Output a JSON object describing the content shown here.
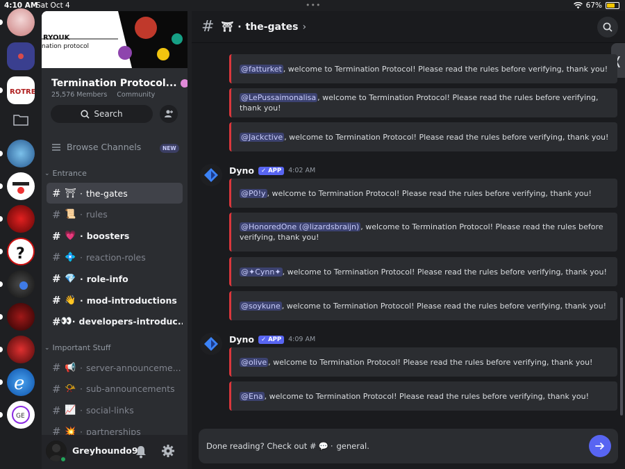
{
  "status_bar": {
    "time": "4:10 AM",
    "date": "Sat Oct 4",
    "battery": "67%",
    "battery_level": 0.67
  },
  "guild": {
    "name": "Termination Protocol...",
    "members": "25,576 Members",
    "type": "Community",
    "banner_text": "nation protocol",
    "banner_logo": "RYOUK",
    "search_label": "Search",
    "browse_label": "Browse Channels",
    "new_badge": "NEW"
  },
  "categories": {
    "entrance": "Entrance",
    "important": "Important Stuff"
  },
  "channels": [
    {
      "emoji": "⛩",
      "name": "the-gates",
      "state": "active"
    },
    {
      "emoji": "📜",
      "name": "rules",
      "state": "muted"
    },
    {
      "emoji": "💗",
      "name": "boosters",
      "state": "unread"
    },
    {
      "emoji": "💠",
      "name": "reaction-roles",
      "state": "muted"
    },
    {
      "emoji": "💎",
      "name": "role-info",
      "state": "unread"
    },
    {
      "emoji": "👋",
      "name": "mod-introductions",
      "state": "unread"
    },
    {
      "emoji": "👀",
      "name": "developers-introduc...",
      "state": "unread"
    },
    {
      "emoji": "📢",
      "name": "server-announceme...",
      "state": "muted"
    },
    {
      "emoji": "📯",
      "name": "sub-announcements",
      "state": "muted"
    },
    {
      "emoji": "📈",
      "name": "social-links",
      "state": "muted"
    },
    {
      "emoji": "💥",
      "name": "partnerships",
      "state": "muted"
    }
  ],
  "user": {
    "name": "Greyhoundo9"
  },
  "header": {
    "emoji": "⛩",
    "channel": "the-gates",
    "chevron": "›",
    "drawer_icon": "❬"
  },
  "welcome_suffix": ", welcome to Termination Protocol! Please read the rules before verifying, thank you!",
  "messages_top": [
    {
      "mention": "@fatturket"
    },
    {
      "mention": "@LePussaimonalisa"
    },
    {
      "mention": "@Jackctive"
    }
  ],
  "group1": {
    "author": "Dyno",
    "badge": "✓ APP",
    "time": "4:02 AM",
    "items": [
      {
        "mention": "@P0!y"
      },
      {
        "mention": "@HonoredOne (@lizardsbraijn)"
      },
      {
        "mention": "@✦Cynn✦"
      },
      {
        "mention": "@soykune"
      }
    ]
  },
  "group2": {
    "author": "Dyno",
    "badge": "✓ APP",
    "time": "4:09 AM",
    "items": [
      {
        "mention": "@olive"
      },
      {
        "mention": "@Ena"
      }
    ]
  },
  "composer": {
    "prefix": "Done reading? Check out #",
    "emoji": "💬",
    "channel": "general."
  },
  "colors": {
    "accent": "#5865f2",
    "embed_bar": "#da373c",
    "online": "#23a55a"
  },
  "icons": [
    "search-icon",
    "add-member-icon",
    "browse-channels-icon",
    "bell-icon",
    "gear-icon",
    "send-icon",
    "dyno-bot-icon",
    "folder-icon",
    "chevron-right-icon"
  ]
}
